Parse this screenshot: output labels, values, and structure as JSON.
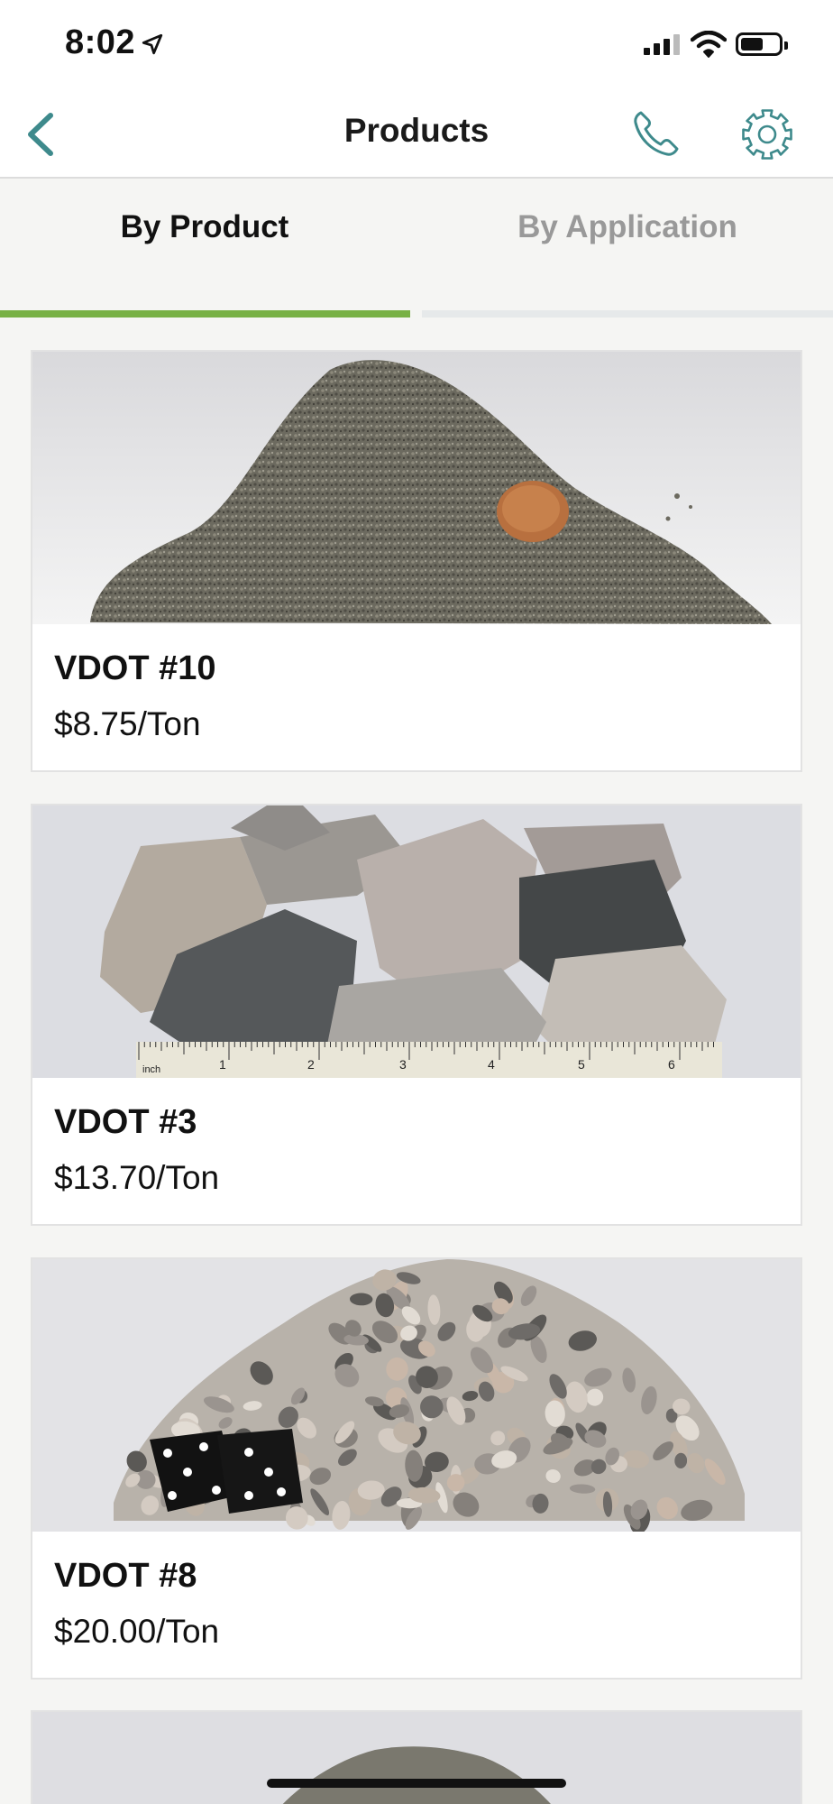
{
  "status": {
    "time": "8:02"
  },
  "nav": {
    "title": "Products",
    "back_icon": "chevron-left-icon",
    "phone_icon": "phone-icon",
    "settings_icon": "gear-icon"
  },
  "tabs": [
    {
      "label": "By Product",
      "active": true
    },
    {
      "label": "By Application",
      "active": false
    }
  ],
  "products": [
    {
      "name": "VDOT #10",
      "price": "$8.75/Ton"
    },
    {
      "name": "VDOT #3",
      "price": "$13.70/Ton"
    },
    {
      "name": "VDOT #8",
      "price": "$20.00/Ton"
    }
  ],
  "ruler_labels": [
    "inch",
    "1",
    "2",
    "3",
    "4",
    "5",
    "6"
  ],
  "colors": {
    "accent": "#78b145",
    "icon_teal": "#3e8a8c",
    "inactive_tab": "#999999"
  }
}
